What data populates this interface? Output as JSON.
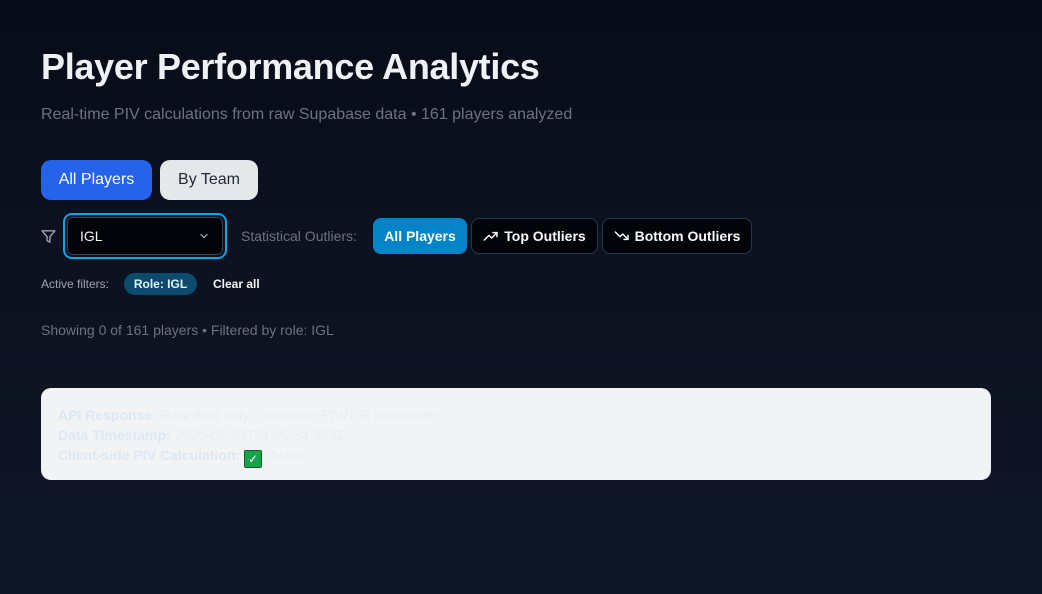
{
  "header": {
    "title": "Player Performance Analytics",
    "subtitle": "Real-time PIV calculations from raw Supabase data • 161 players analyzed"
  },
  "view_toggle": {
    "all_players": "All Players",
    "by_team": "By Team",
    "selected": "All Players"
  },
  "filters": {
    "filter_icon": "filter-icon",
    "role_select": {
      "value": "IGL",
      "icon": "chevron-down-icon"
    },
    "outliers_label": "Statistical Outliers:",
    "outlier_buttons": {
      "all": "All Players",
      "top": "Top Outliers",
      "bottom": "Bottom Outliers"
    },
    "active_filters_label": "Active filters:",
    "active_chip": "Role: IGL",
    "clear_all": "Clear all"
  },
  "status": {
    "showing": "Showing 0 of 161 players • Filtered by role: IGL"
  },
  "debug": {
    "api_label": "API Response:",
    "api_value": " Raw data only - calculate PIV/TIR client-side",
    "timestamp_label": "Data Timestamp:",
    "timestamp_value": " 2025-05-30T21:09:34.329Z",
    "piv_label": "Client-side PIV Calculation:",
    "piv_check": "✓",
    "piv_value": " Active"
  },
  "colors": {
    "accent_blue": "#2563eb",
    "outlier_active": "#0284c7",
    "chip_bg": "#0c4a6e",
    "select_focus": "#0ea5e9"
  }
}
